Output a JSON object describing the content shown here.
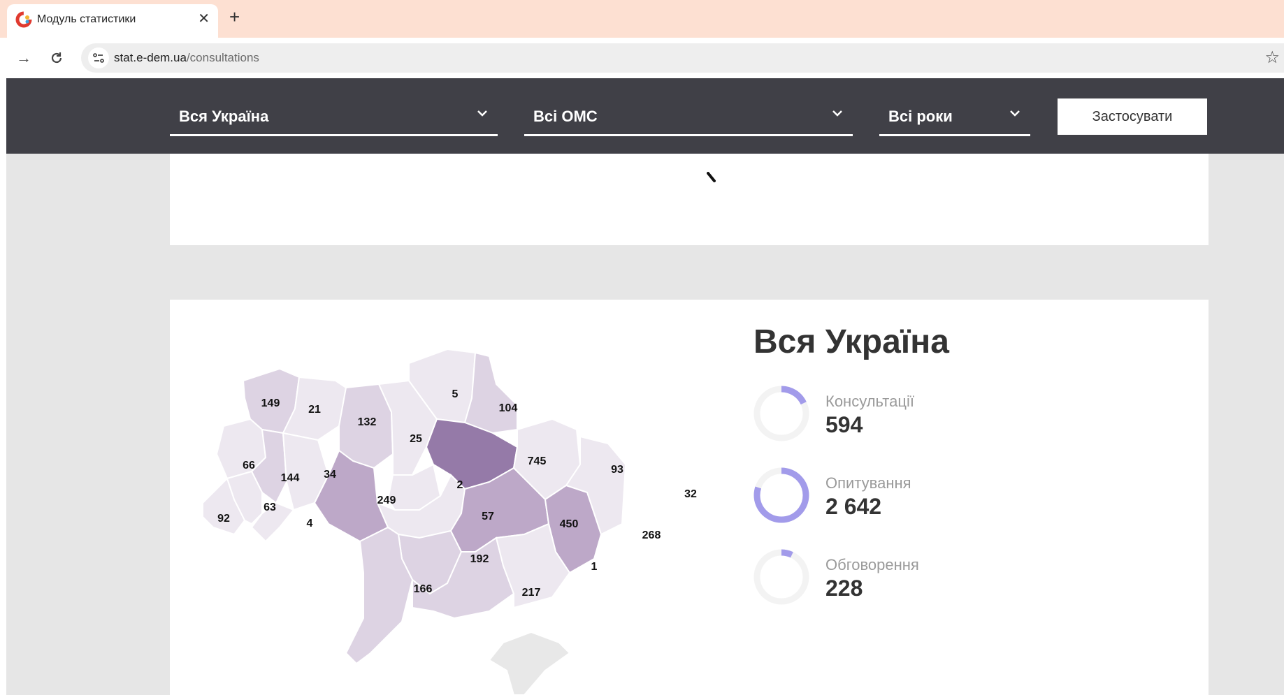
{
  "browser": {
    "tab_title": "Модуль статистики",
    "url_host": "stat.e-dem.ua",
    "url_path": "/consultations"
  },
  "filters": {
    "region": "Вся Україна",
    "oms": "Всі ОМС",
    "years": "Всі роки",
    "apply_label": "Застосувати"
  },
  "summary": {
    "title": "Вся Україна",
    "stats": [
      {
        "label": "Консультації",
        "value": "594",
        "fraction": 0.18
      },
      {
        "label": "Опитування",
        "value": "2 642",
        "fraction": 0.8
      },
      {
        "label": "Обговорення",
        "value": "228",
        "fraction": 0.07
      }
    ]
  },
  "map_values": {
    "volyn": "149",
    "rivne": "21",
    "zhytomyr": "132",
    "kyiv_obl": "25",
    "chernihiv": "5",
    "sumy": "104",
    "lviv": "66",
    "ternopil": "144",
    "khmelnytskyi": "34",
    "vinnytsia": "249",
    "kyiv_city": "2",
    "poltava": "745",
    "kharkiv": "93",
    "luhansk": "32",
    "zakarpattia": "92",
    "ivano_frankivsk": "63",
    "chernivtsi": "4",
    "cherkasy": "57",
    "kirovohrad": "192",
    "dnipro": "450",
    "donetsk": "268",
    "odesa": "166",
    "mykolaiv": "217",
    "zaporizhzhia": "1"
  },
  "colors": {
    "filterbar": "#404047",
    "accent_ring": "#a29bea",
    "map_dark": "#957aa8",
    "map_mid": "#bda8c8",
    "map_light": "#ddd3e3",
    "map_lightest": "#ede8f0"
  }
}
